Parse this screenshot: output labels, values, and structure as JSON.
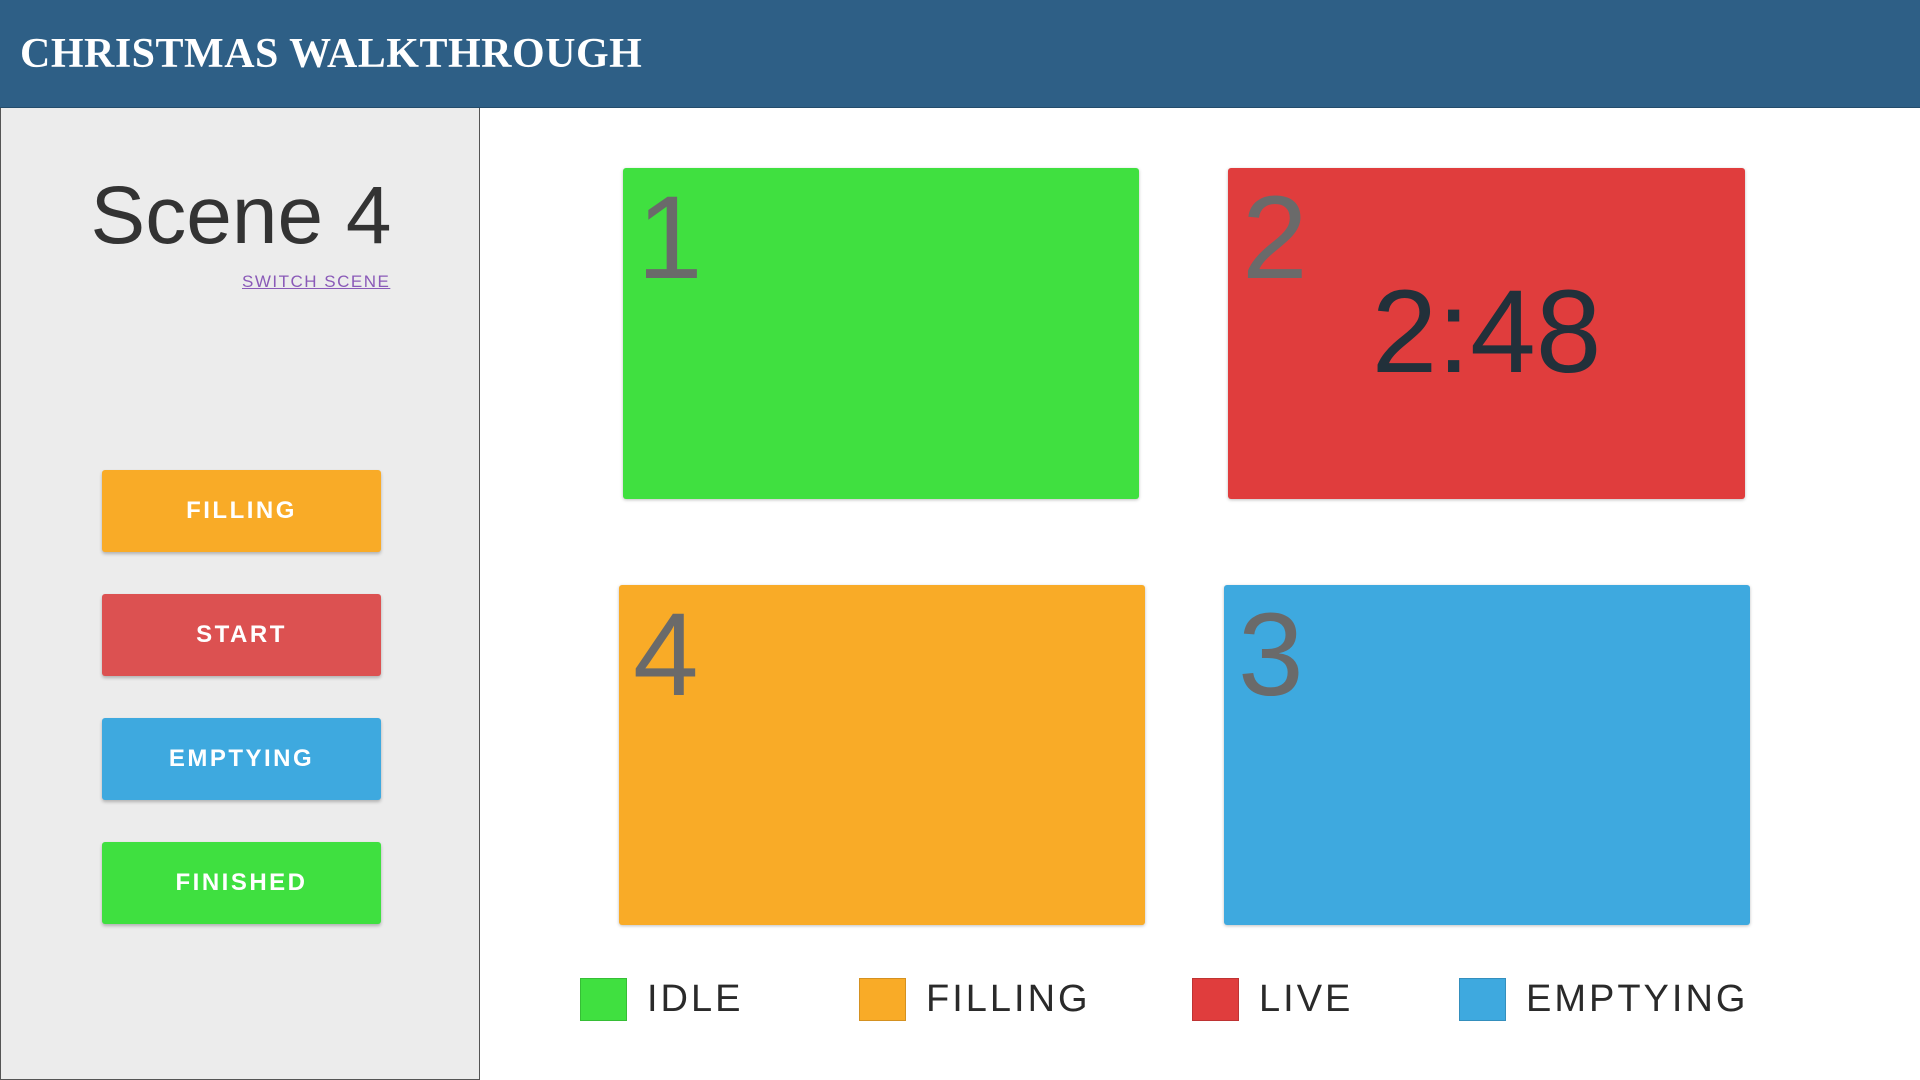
{
  "header": {
    "title": "CHRISTMAS WALKTHROUGH"
  },
  "sidebar": {
    "scene_title": "Scene 4",
    "switch_scene_label": "SWITCH SCENE",
    "buttons": [
      {
        "label": "FILLING",
        "color": "#f9ab27"
      },
      {
        "label": "START",
        "color": "#dc5151"
      },
      {
        "label": "EMPTYING",
        "color": "#3ea9df"
      },
      {
        "label": "FINISHED",
        "color": "#3fe040"
      }
    ]
  },
  "zones": [
    {
      "number": "1",
      "status": "idle",
      "color": "#40e040",
      "timer": ""
    },
    {
      "number": "2",
      "status": "live",
      "color": "#e03d3d",
      "timer": "2:48"
    },
    {
      "number": "4",
      "status": "filling",
      "color": "#f9ab27",
      "timer": ""
    },
    {
      "number": "3",
      "status": "emptying",
      "color": "#3ea9df",
      "timer": ""
    }
  ],
  "legend": [
    {
      "label": "IDLE",
      "color": "#40e040"
    },
    {
      "label": "FILLING",
      "color": "#f9ab27"
    },
    {
      "label": "LIVE",
      "color": "#e03d3d"
    },
    {
      "label": "EMPTYING",
      "color": "#3ea9df"
    }
  ]
}
